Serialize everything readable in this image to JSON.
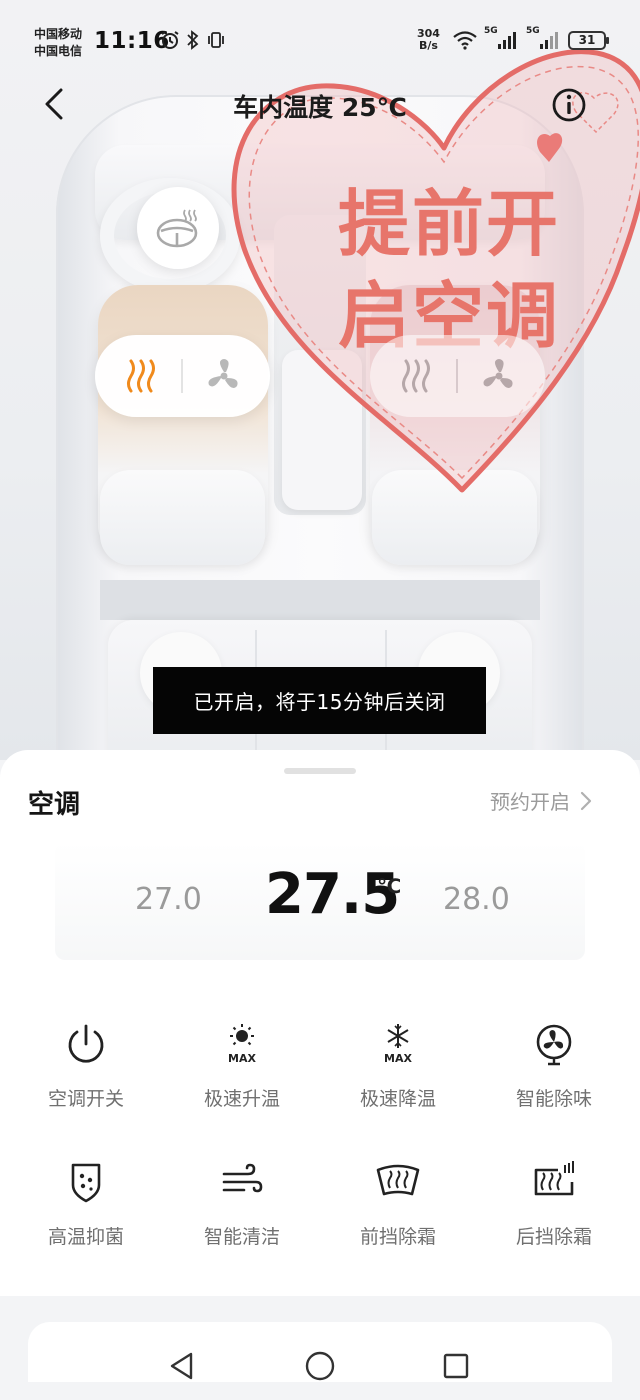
{
  "status_bar": {
    "carrier_1": "中国移动",
    "carrier_2": "中国电信",
    "time": "11:16",
    "net_speed_value": "304",
    "net_speed_unit": "B/s",
    "signal_1_label": "5G",
    "signal_2_label": "5G",
    "battery": "31"
  },
  "header": {
    "title": "车内温度 25℃"
  },
  "sticker": {
    "line1": "提前开",
    "line2": "启空调",
    "color": "#e7756b"
  },
  "seats": {
    "driver_heat_icon": "seat-heat-icon",
    "driver_fan_icon": "seat-fan-icon",
    "heat_active_color": "#f08a1c"
  },
  "toast": {
    "text": "已开启，将于15分钟后关闭"
  },
  "panel": {
    "title": "空调",
    "schedule_label": "预约开启",
    "temp_low": "27.0",
    "temp_current": "27.5",
    "temp_unit": "℃",
    "temp_high": "28.0"
  },
  "functions": [
    {
      "label": "空调开关",
      "icon": "power-icon"
    },
    {
      "label": "极速升温",
      "icon": "sun-max-icon"
    },
    {
      "label": "极速降温",
      "icon": "snowflake-max-icon"
    },
    {
      "label": "智能除味",
      "icon": "fan-icon"
    },
    {
      "label": "高温抑菌",
      "icon": "shield-dots-icon"
    },
    {
      "label": "智能清洁",
      "icon": "wind-icon"
    },
    {
      "label": "前挡除霜",
      "icon": "front-defrost-icon"
    },
    {
      "label": "后挡除霜",
      "icon": "rear-defrost-icon"
    }
  ],
  "icon_texts": {
    "max": "MAX"
  }
}
